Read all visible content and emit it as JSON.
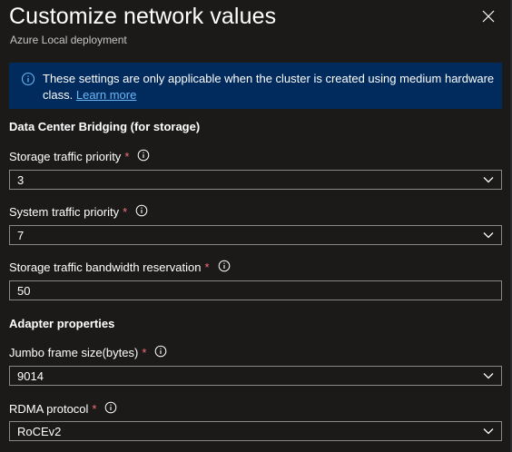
{
  "header": {
    "title": "Customize network values",
    "subtitle": "Azure Local deployment",
    "close_icon": "close-icon"
  },
  "banner": {
    "text": "These settings are only applicable when the cluster is created using medium hardware class.",
    "link": "Learn more",
    "icon": "info-icon",
    "background": "#012a5d",
    "link_color": "#6cb8f6"
  },
  "dcb": {
    "heading": "Data Center Bridging (for storage)",
    "storage_priority": {
      "label": "Storage traffic priority",
      "required": "*",
      "value": "3"
    },
    "system_priority": {
      "label": "System traffic priority",
      "required": "*",
      "value": "7"
    },
    "bandwidth": {
      "label": "Storage traffic bandwidth reservation",
      "required": "*",
      "value": "50"
    }
  },
  "adapter": {
    "heading": "Adapter properties",
    "jumbo_frame": {
      "label": "Jumbo frame size(bytes)",
      "required": "*",
      "value": "9014"
    },
    "rdma": {
      "label": "RDMA protocol",
      "required": "*",
      "value": "RoCEv2"
    }
  },
  "colors": {
    "background": "#1b1a19",
    "required": "#f1707b",
    "border": "#8a8886"
  }
}
